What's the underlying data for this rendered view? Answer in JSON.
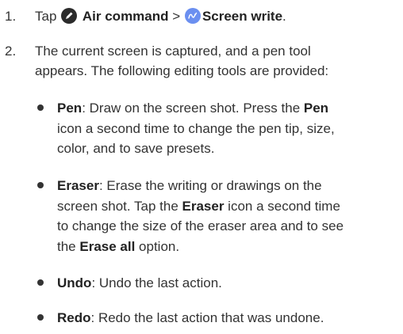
{
  "steps": [
    {
      "number": "1.",
      "prefix": "Tap",
      "air_command": "Air command",
      "separator": ">",
      "screen_write": "Screen write",
      "suffix": "."
    },
    {
      "number": "2.",
      "lines": [
        "The current screen is captured, and a pen tool",
        "appears. The following editing tools are provided:"
      ]
    }
  ],
  "tools": [
    {
      "name": "Pen",
      "lines": [
        [
          ": Draw on the screen shot. Press the ",
          "Pen",
          ""
        ],
        [
          "icon a second time to change the pen tip, size,"
        ],
        [
          "color, and to save presets."
        ]
      ]
    },
    {
      "name": "Eraser",
      "lines": [
        [
          ": Erase the writing or drawings on the"
        ],
        [
          "screen shot. Tap the ",
          "Eraser",
          " icon a second time"
        ],
        [
          "to change the size of the eraser area and to see"
        ],
        [
          "the ",
          "Erase all",
          " option."
        ]
      ]
    },
    {
      "name": "Undo",
      "lines": [
        [
          ": Undo the last action."
        ]
      ]
    },
    {
      "name": "Redo",
      "lines": [
        [
          ": Redo the last action that was undone."
        ]
      ]
    }
  ],
  "icons": {
    "air_command": "air-command-icon",
    "screen_write": "screen-write-icon"
  },
  "colors": {
    "text": "#333333",
    "air_command_icon": "#2b2b2b",
    "screen_write_icon": "#6b8ff0"
  }
}
